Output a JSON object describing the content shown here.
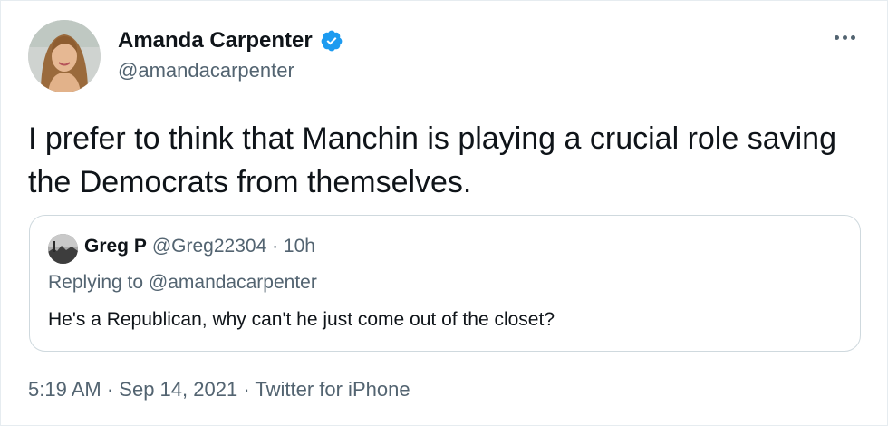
{
  "tweet": {
    "author_name": "Amanda Carpenter",
    "author_handle": "@amandacarpenter",
    "verified_icon": "verified-badge-icon",
    "text": "I prefer to think that Manchin is playing a crucial role saving the Democrats from themselves.",
    "timestamp_time": "5:19 AM",
    "timestamp_sep1": "·",
    "timestamp_date": "Sep 14, 2021",
    "timestamp_sep2": "·",
    "source": "Twitter for iPhone"
  },
  "quote": {
    "name": "Greg P",
    "meta": "@Greg22304 · 10h",
    "replying": "Replying to @amandacarpenter",
    "text": "He's a Republican, why can't he just come out of the closet?"
  },
  "colors": {
    "verified": "#1d9bf0",
    "secondary_text": "#536471",
    "border": "#cfd9de"
  }
}
